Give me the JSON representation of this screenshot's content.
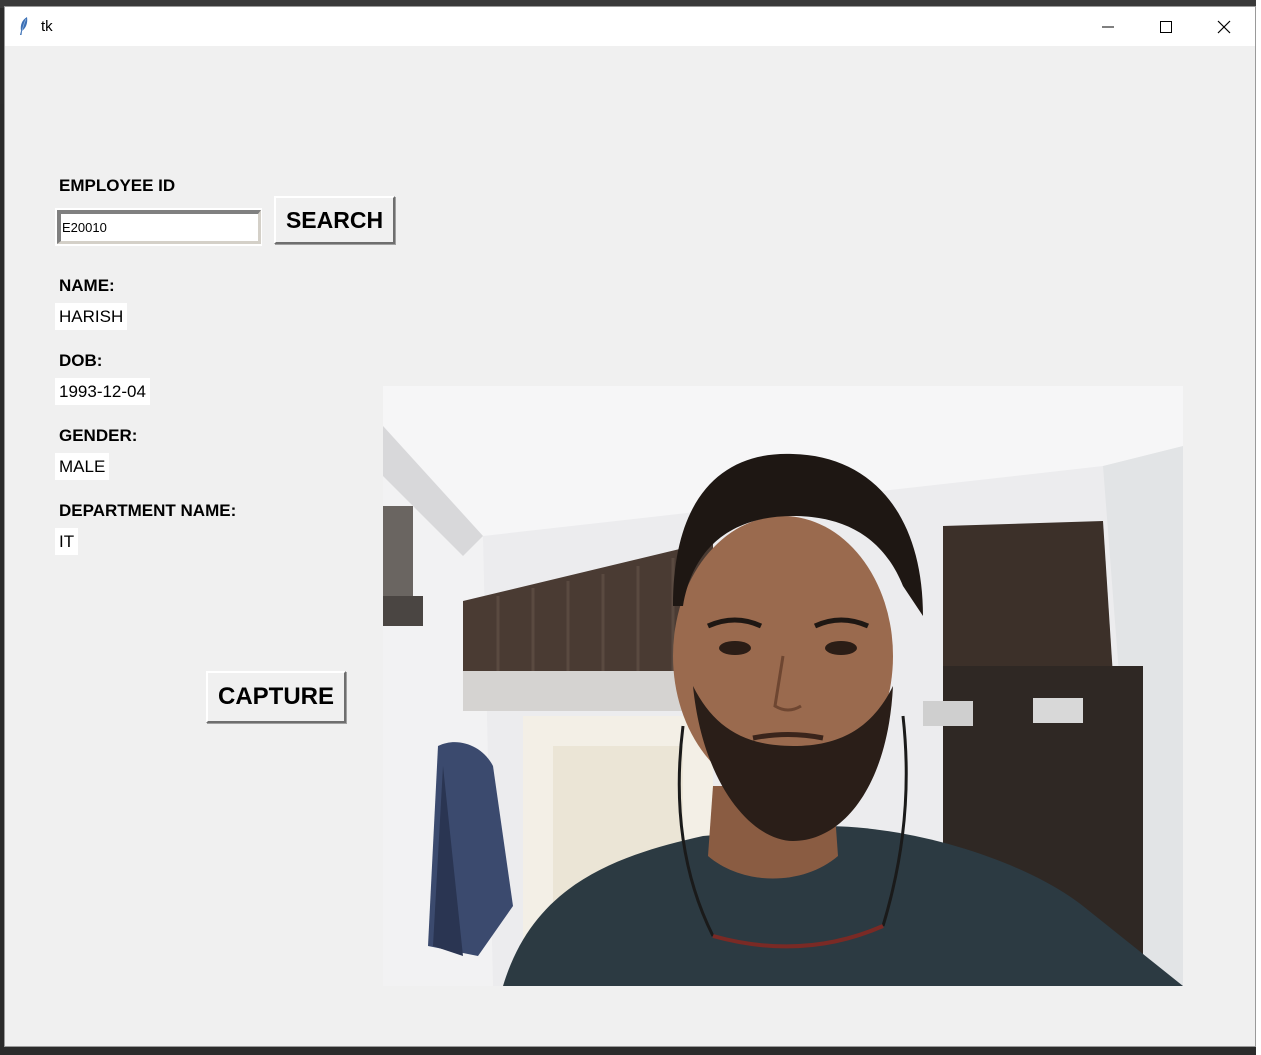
{
  "window": {
    "title": "tk"
  },
  "form": {
    "employee_id_label": "EMPLOYEE ID",
    "employee_id_value": "E20010",
    "search_label": "SEARCH",
    "name_label": "NAME:",
    "name_value": "HARISH",
    "dob_label": "DOB:",
    "dob_value": "1993-12-04",
    "gender_label": "GENDER:",
    "gender_value": "MALE",
    "department_label": "DEPARTMENT NAME:",
    "department_value": "IT",
    "capture_label": "CAPTURE"
  },
  "icons": {
    "app": "feather-icon",
    "minimize": "minimize-icon",
    "maximize": "maximize-icon",
    "close": "close-icon"
  },
  "colors": {
    "window_bg": "#f0f0f0",
    "titlebar_bg": "#ffffff",
    "value_bg": "#ffffff"
  }
}
